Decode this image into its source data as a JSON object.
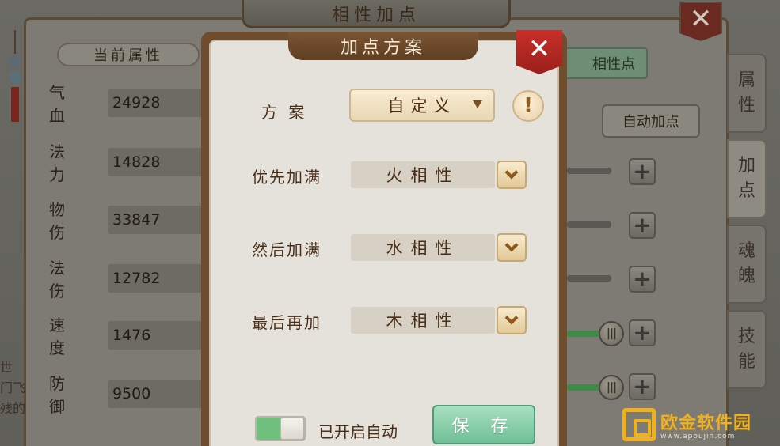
{
  "background": {
    "title": "相性加点",
    "current_attr_tab": "当前属性",
    "points_tab": "相性点",
    "auto_add_button": "自动加点",
    "stats": [
      {
        "label": "气 血",
        "value": "24928"
      },
      {
        "label": "法 力",
        "value": "14828"
      },
      {
        "label": "物 伤",
        "value": "33847"
      },
      {
        "label": "法 伤",
        "value": "12782"
      },
      {
        "label": "速 度",
        "value": "1476"
      },
      {
        "label": "防 御",
        "value": "9500"
      }
    ],
    "side_tabs": [
      {
        "label": "属\n性",
        "name": "side-tab-attributes"
      },
      {
        "label": "加\n点",
        "name": "side-tab-add-points"
      },
      {
        "label": "魂\n魄",
        "name": "side-tab-soul"
      },
      {
        "label": "技\n能",
        "name": "side-tab-skills"
      }
    ],
    "left_edge_text": "世\n门飞\n残的"
  },
  "dialog": {
    "title": "加点方案",
    "scheme_label": "方  案",
    "scheme_value": "自定义",
    "rows": [
      {
        "label": "优先加满",
        "value": "火相性"
      },
      {
        "label": "然后加满",
        "value": "水相性"
      },
      {
        "label": "最后再加",
        "value": "木相性"
      }
    ],
    "toggle_label": "已开启自动",
    "toggle_on": true,
    "save_button": "保 存"
  },
  "watermark": {
    "main": "欧金软件园",
    "sub": "www.apoujin.com"
  },
  "colors": {
    "dialog_frame": "#6f4c2d",
    "dialog_body": "#e5e2db",
    "close_red": "#c8302a",
    "save_green": "#6fbf97",
    "watermark_gold": "#f0b11c"
  }
}
